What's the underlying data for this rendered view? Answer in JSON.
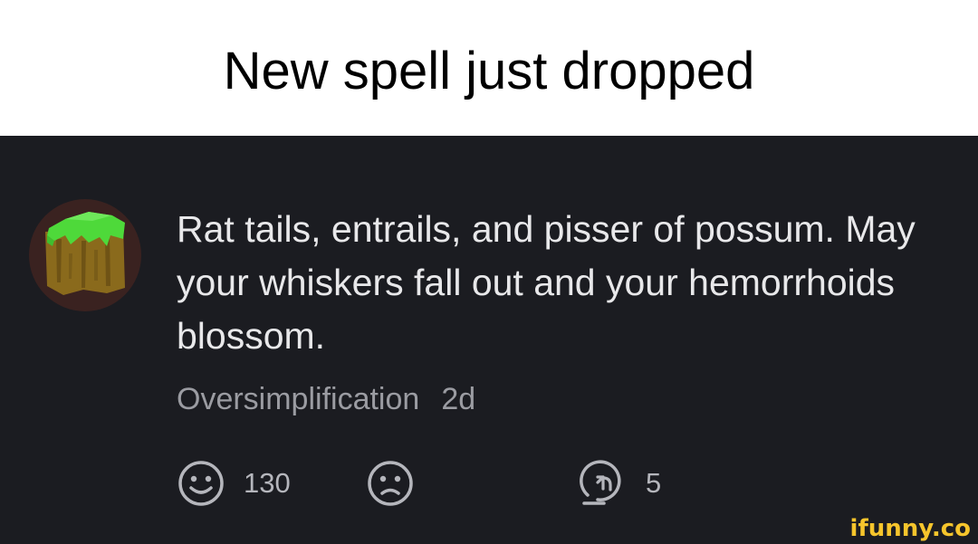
{
  "caption": "New spell just dropped",
  "comment": {
    "text": "Rat tails, entrails, and pisser of possum. May your whiskers fall out and your hemorrhoids blossom.",
    "author": "Oversimplification",
    "age": "2d",
    "avatar_icon": "grass-block-icon"
  },
  "actions": {
    "smile_icon": "smile-icon",
    "smile_count": "130",
    "frown_icon": "frown-icon",
    "reply_icon": "reply-icon",
    "reply_count": "5"
  },
  "watermark": "ifunny.co",
  "colors": {
    "card_background": "#1b1c21",
    "text": "#e8e8ea",
    "meta": "#9b9ca2",
    "watermark": "#f6c52c"
  }
}
